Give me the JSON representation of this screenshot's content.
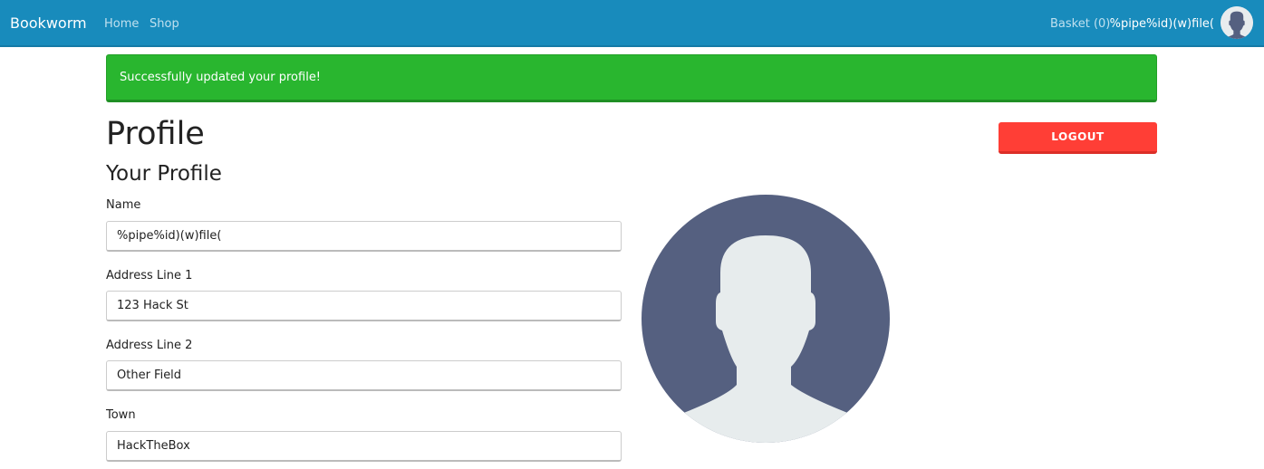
{
  "navbar": {
    "brand": "Bookworm",
    "links": [
      {
        "label": "Home"
      },
      {
        "label": "Shop"
      }
    ],
    "basket_label": "Basket (0)",
    "username": "%pipe%id)(w)file(",
    "avatar_icon": "user-avatar-icon"
  },
  "alert": {
    "message": "Successfully updated your profile!",
    "color": "#29b62f"
  },
  "page": {
    "title": "Profile",
    "logout_label": "LOGOUT",
    "logout_color": "#ff3e36"
  },
  "profile": {
    "heading": "Your Profile",
    "fields": [
      {
        "label": "Name",
        "value": "%pipe%id)(w)file("
      },
      {
        "label": "Address Line 1",
        "value": "123 Hack St"
      },
      {
        "label": "Address Line 2",
        "value": "Other Field"
      },
      {
        "label": "Town",
        "value": "HackTheBox"
      }
    ],
    "avatar_icon": "default-user-silhouette-icon"
  },
  "colors": {
    "navbar": "#188bbc",
    "avatar_bg": "#556080",
    "silhouette": "#e7eced"
  }
}
